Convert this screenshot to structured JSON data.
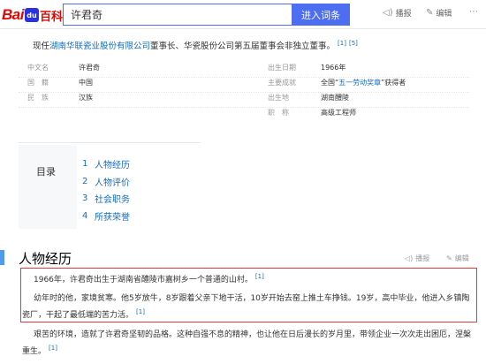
{
  "header": {
    "logo": {
      "bai": "Bai",
      "paw": "du",
      "bk": "百科"
    },
    "search_value": "许君奇",
    "search_button": "进入词条",
    "actions": [
      {
        "icon": "speaker-icon",
        "glyph": "◁)",
        "label": "播报"
      },
      {
        "icon": "edit-icon",
        "glyph": "✎",
        "label": "编辑"
      },
      {
        "icon": "more-icon",
        "glyph": "⋯",
        "label": ""
      }
    ]
  },
  "intro": {
    "prefix": "现任",
    "company": "湖南华联瓷业股份有限公司",
    "suffix": "董事长、华瓷股份公司第五届董事会非独立董事。",
    "refs": [
      "[1]",
      "[5]"
    ]
  },
  "basic_info": {
    "left": [
      {
        "name": "中文名",
        "value": "许君奇",
        "link": false
      },
      {
        "name": "国　籍",
        "value": "中国",
        "link": true
      },
      {
        "name": "民　族",
        "value": "汉族",
        "link": false
      }
    ],
    "right": [
      {
        "name": "出生日期",
        "value": "1966年",
        "link": false
      },
      {
        "name": "主要成就",
        "value_pre": "全国“",
        "value_link": "五一劳动奖章",
        "value_post": "”获得者"
      },
      {
        "name": "出生地",
        "value": "湖南醴陵",
        "link": false
      },
      {
        "name": "职　称",
        "value": "高级工程师",
        "link": false
      }
    ]
  },
  "catalog": {
    "title": "目录",
    "items": [
      {
        "num": "1",
        "label": "人物经历"
      },
      {
        "num": "2",
        "label": "人物评价"
      },
      {
        "num": "3",
        "label": "社会职务"
      },
      {
        "num": "4",
        "label": "所获荣誉"
      }
    ]
  },
  "section": {
    "title": "人物经历",
    "play_label": "播报",
    "edit_label": "编辑",
    "paragraphs": [
      {
        "text": "1966年，许君奇出生于湖南省醴陵市嘉树乡一个普通的山村。",
        "ref": "[1]"
      },
      {
        "text": "幼年时的他，家境贫寒。他5岁放牛，8岁跟着父亲下地干活，10岁开始去窑上推土车挣钱。19岁，高中毕业，他进入乡镇陶瓷厂，干起了最低端的苦力活。",
        "ref": "[1]"
      },
      {
        "text": "艰苦的环境，造就了许君奇坚韧的品格。这种自强不息的精神，也让他在日后漫长的岁月里，带领企业一次次走出困厄，涅槃重生。",
        "ref": "[1]"
      }
    ]
  }
}
